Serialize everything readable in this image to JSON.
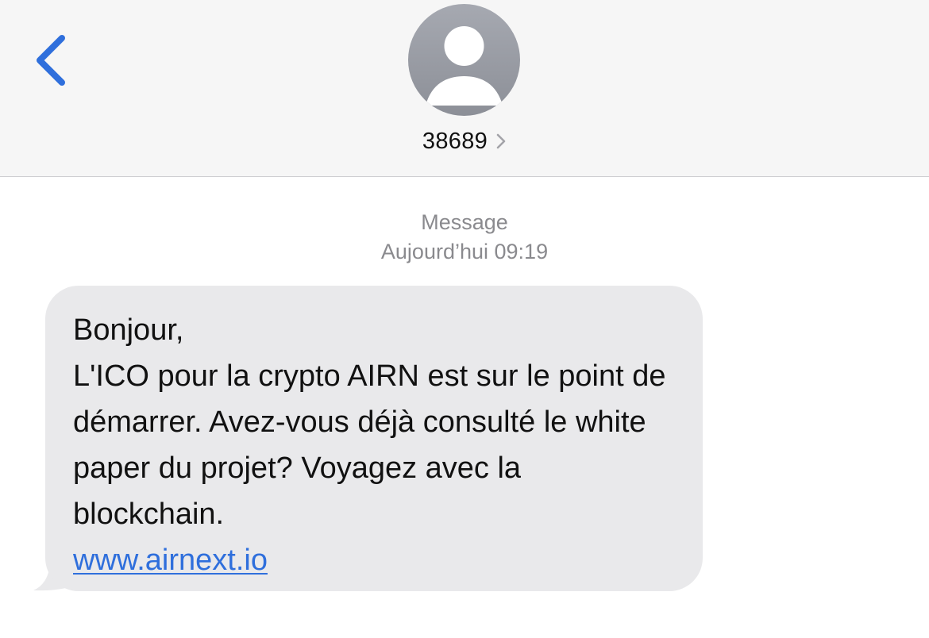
{
  "header": {
    "back_icon": "chevron-left-icon",
    "avatar_icon": "person-silhouette-icon",
    "contact_name": "38689",
    "contact_chevron_icon": "chevron-right-icon"
  },
  "conversation": {
    "service_label": "Message",
    "timestamp_day": "Aujourd’hui",
    "timestamp_time": "09:19",
    "message": {
      "direction": "incoming",
      "text": "Bonjour,\nL'ICO pour la crypto AIRN  est sur le point de démarrer. Avez-vous déjà consulté le white paper du projet? Voyagez avec la blockchain.",
      "link": "www.airnext.io"
    }
  },
  "colors": {
    "accent_blue": "#2f6fdc",
    "header_background": "#f6f6f6",
    "bubble_background": "#e9e9eb",
    "avatar_gray": "#9a9da5",
    "meta_gray": "#8a8a8e"
  }
}
